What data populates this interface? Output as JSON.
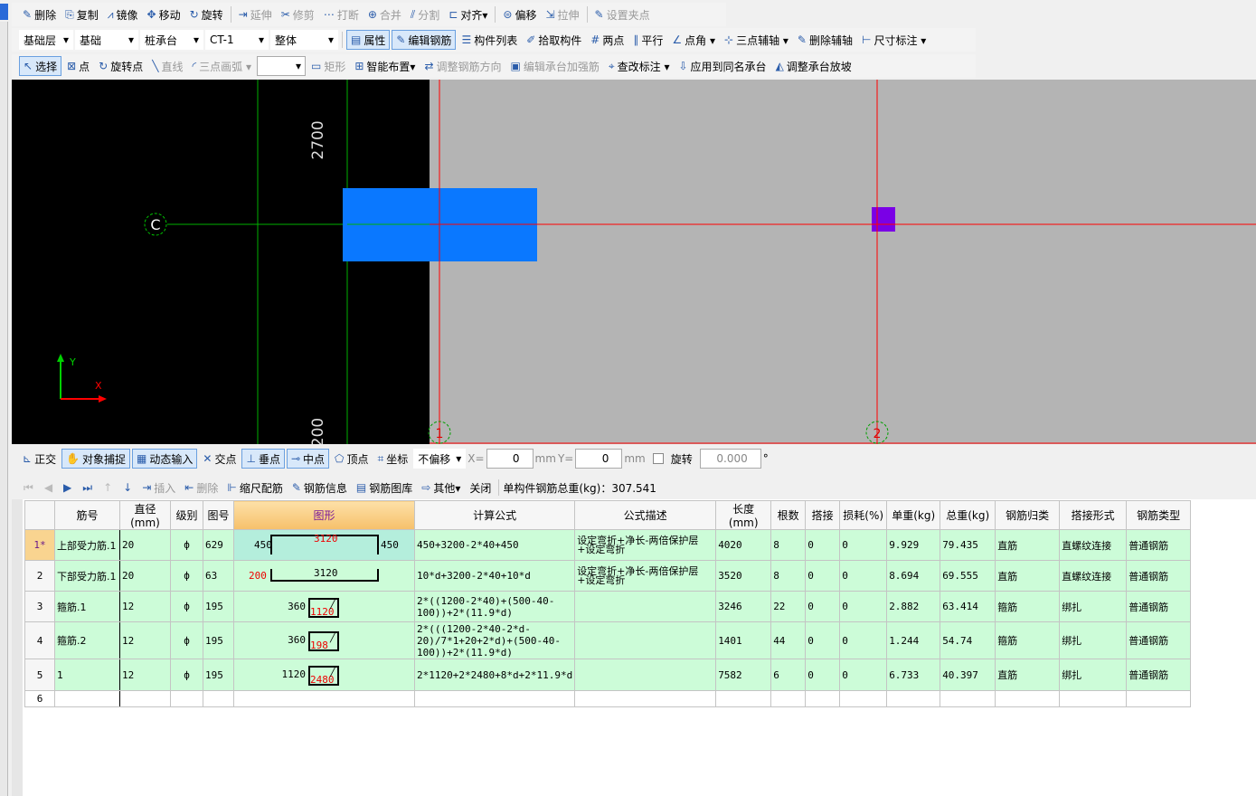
{
  "toolbar1": [
    {
      "icon": "delete-icon",
      "label": "删除"
    },
    {
      "icon": "copy-icon",
      "label": "复制"
    },
    {
      "icon": "mirror-icon",
      "label": "镜像"
    },
    {
      "icon": "move-icon",
      "label": "移动"
    },
    {
      "icon": "rotate-icon",
      "label": "旋转"
    },
    {
      "icon": "extend-icon",
      "label": "延伸",
      "disabled": true
    },
    {
      "icon": "trim-icon",
      "label": "修剪",
      "disabled": true
    },
    {
      "icon": "break-icon",
      "label": "打断",
      "disabled": true
    },
    {
      "icon": "merge-icon",
      "label": "合并",
      "disabled": true
    },
    {
      "icon": "split-icon",
      "label": "分割",
      "disabled": true
    },
    {
      "icon": "align-icon",
      "label": "对齐▾"
    },
    {
      "icon": "offset-icon",
      "label": "偏移"
    },
    {
      "icon": "stretch-icon",
      "label": "拉伸",
      "disabled": true
    },
    {
      "icon": "set-grip-icon",
      "label": "设置夹点",
      "disabled": true
    }
  ],
  "toolbar2": {
    "selects": [
      "基础层",
      "基础",
      "桩承台",
      "CT-1",
      "整体"
    ],
    "items": [
      {
        "icon": "properties-icon",
        "label": "属性",
        "active": true
      },
      {
        "icon": "edit-rebar-icon",
        "label": "编辑钢筋",
        "active": true
      },
      {
        "icon": "component-list-icon",
        "label": "构件列表"
      },
      {
        "icon": "pick-component-icon",
        "label": "拾取构件"
      },
      {
        "icon": "two-point-icon",
        "label": "两点"
      },
      {
        "icon": "parallel-icon",
        "label": "平行"
      },
      {
        "icon": "point-angle-icon",
        "label": "点角 ▾"
      },
      {
        "icon": "three-point-axis-icon",
        "label": "三点辅轴 ▾"
      },
      {
        "icon": "delete-aux-icon",
        "label": "删除辅轴"
      },
      {
        "icon": "dimension-icon",
        "label": "尺寸标注 ▾"
      }
    ]
  },
  "toolbar3": [
    {
      "icon": "select-icon",
      "label": "选择",
      "active": true
    },
    {
      "icon": "point-icon",
      "label": "点"
    },
    {
      "icon": "rotate-point-icon",
      "label": "旋转点"
    },
    {
      "icon": "line-icon",
      "label": "直线",
      "disabled": true
    },
    {
      "icon": "arc-icon",
      "label": "三点画弧 ▾",
      "disabled": true
    },
    {
      "icon": "rectangle-icon",
      "label": "矩形",
      "disabled": true
    },
    {
      "icon": "smart-layout-icon",
      "label": "智能布置▾"
    },
    {
      "icon": "adjust-direction-icon",
      "label": "调整钢筋方向",
      "disabled": true
    },
    {
      "icon": "edit-cap-icon",
      "label": "编辑承台加强筋",
      "disabled": true
    },
    {
      "icon": "check-dim-icon",
      "label": "查改标注 ▾"
    },
    {
      "icon": "apply-same-icon",
      "label": "应用到同名承台"
    },
    {
      "icon": "adjust-slope-icon",
      "label": "调整承台放坡"
    }
  ],
  "canvas": {
    "axis_c": "C",
    "axis_1": "1",
    "axis_2": "2",
    "dim_top": "2700",
    "dim_bottom": "200",
    "y_label": "Y",
    "x_label": "X",
    "colors": {
      "cap": "#0a78ff",
      "column": "#7a00e6",
      "axis_red": "#ff0000",
      "axis_green": "#00b000"
    }
  },
  "snapbar": {
    "items": [
      {
        "icon": "ortho-icon",
        "label": "正交"
      },
      {
        "icon": "object-snap-icon",
        "label": "对象捕捉",
        "active": true
      },
      {
        "icon": "dynamic-input-icon",
        "label": "动态输入",
        "active": true
      },
      {
        "icon": "intersection-icon",
        "label": "交点"
      },
      {
        "icon": "perpendicular-icon",
        "label": "垂点",
        "active": true
      },
      {
        "icon": "midpoint-icon",
        "label": "中点",
        "active": true
      },
      {
        "icon": "vertex-icon",
        "label": "顶点"
      },
      {
        "icon": "coordinate-icon",
        "label": "坐标"
      }
    ],
    "offset": "不偏移",
    "x_label": "X=",
    "x": "0",
    "y_label": "Y=",
    "y": "0",
    "unit": "mm",
    "rotate_label": "旋转",
    "rotate": "0.000",
    "deg": "°"
  },
  "rebarbar": {
    "items": [
      {
        "icon": "insert-icon",
        "label": "插入",
        "disabled": true
      },
      {
        "icon": "delete-row-icon",
        "label": "删除",
        "disabled": true
      },
      {
        "icon": "scale-rebar-icon",
        "label": "缩尺配筋"
      },
      {
        "icon": "rebar-info-icon",
        "label": "钢筋信息"
      },
      {
        "icon": "rebar-library-icon",
        "label": "钢筋图库"
      },
      {
        "icon": "other-icon",
        "label": "其他▾"
      },
      {
        "icon": "",
        "label": "关闭"
      }
    ],
    "total": "单构件钢筋总重(kg)：307.541"
  },
  "table": {
    "headers": [
      "",
      "筋号",
      "直径(mm)",
      "级别",
      "图号",
      "图形",
      "计算公式",
      "公式描述",
      "长度(mm)",
      "根数",
      "搭接",
      "损耗(%)",
      "单重(kg)",
      "总重(kg)",
      "钢筋归类",
      "搭接形式",
      "钢筋类型"
    ],
    "rows": [
      {
        "n": "1*",
        "name": "上部受力筋.1",
        "d": "20",
        "grade": "ф",
        "fig": "629",
        "shape": {
          "kind": "u-up",
          "left": "450",
          "mid": "3120",
          "right": "450"
        },
        "formula": "450+3200-2*40+450",
        "desc": "设定弯折+净长-两倍保护层+设定弯折",
        "len": "4020",
        "count": "8",
        "lap": "0",
        "loss": "0",
        "unit": "9.929",
        "total": "79.435",
        "cat": "直筋",
        "lapType": "直螺纹连接",
        "type": "普通钢筋"
      },
      {
        "n": "2",
        "name": "下部受力筋.1",
        "d": "20",
        "grade": "ф",
        "fig": "63",
        "shape": {
          "kind": "u",
          "left": "200",
          "mid": "3120",
          "right": ""
        },
        "formula": "10*d+3200-2*40+10*d",
        "desc": "设定弯折+净长-两倍保护层+设定弯折",
        "len": "3520",
        "count": "8",
        "lap": "0",
        "loss": "0",
        "unit": "8.694",
        "total": "69.555",
        "cat": "直筋",
        "lapType": "直螺纹连接",
        "type": "普通钢筋"
      },
      {
        "n": "3",
        "name": "箍筋.1",
        "d": "12",
        "grade": "ф",
        "fig": "195",
        "shape": {
          "kind": "stirrup",
          "left": "360",
          "mid": "1120",
          "right": ""
        },
        "formula": "2*((1200-2*40)+(500-40-100))+2*(11.9*d)",
        "desc": "",
        "len": "3246",
        "count": "22",
        "lap": "0",
        "loss": "0",
        "unit": "2.882",
        "total": "63.414",
        "cat": "箍筋",
        "lapType": "绑扎",
        "type": "普通钢筋"
      },
      {
        "n": "4",
        "name": "箍筋.2",
        "d": "12",
        "grade": "ф",
        "fig": "195",
        "shape": {
          "kind": "stirrup",
          "left": "360",
          "mid": "198",
          "right": ""
        },
        "formula": "2*(((1200-2*40-2*d-20)/7*1+20+2*d)+(500-40-100))+2*(11.9*d)",
        "desc": "",
        "len": "1401",
        "count": "44",
        "lap": "0",
        "loss": "0",
        "unit": "1.244",
        "total": "54.74",
        "cat": "箍筋",
        "lapType": "绑扎",
        "type": "普通钢筋"
      },
      {
        "n": "5",
        "name": "1",
        "d": "12",
        "grade": "ф",
        "fig": "195",
        "shape": {
          "kind": "stirrup",
          "left": "1120",
          "mid": "2480",
          "right": ""
        },
        "formula": "2*1120+2*2480+8*d+2*11.9*d",
        "desc": "",
        "len": "7582",
        "count": "6",
        "lap": "0",
        "loss": "0",
        "unit": "6.733",
        "total": "40.397",
        "cat": "直筋",
        "lapType": "绑扎",
        "type": "普通钢筋"
      },
      {
        "n": "6",
        "empty": true
      }
    ]
  }
}
